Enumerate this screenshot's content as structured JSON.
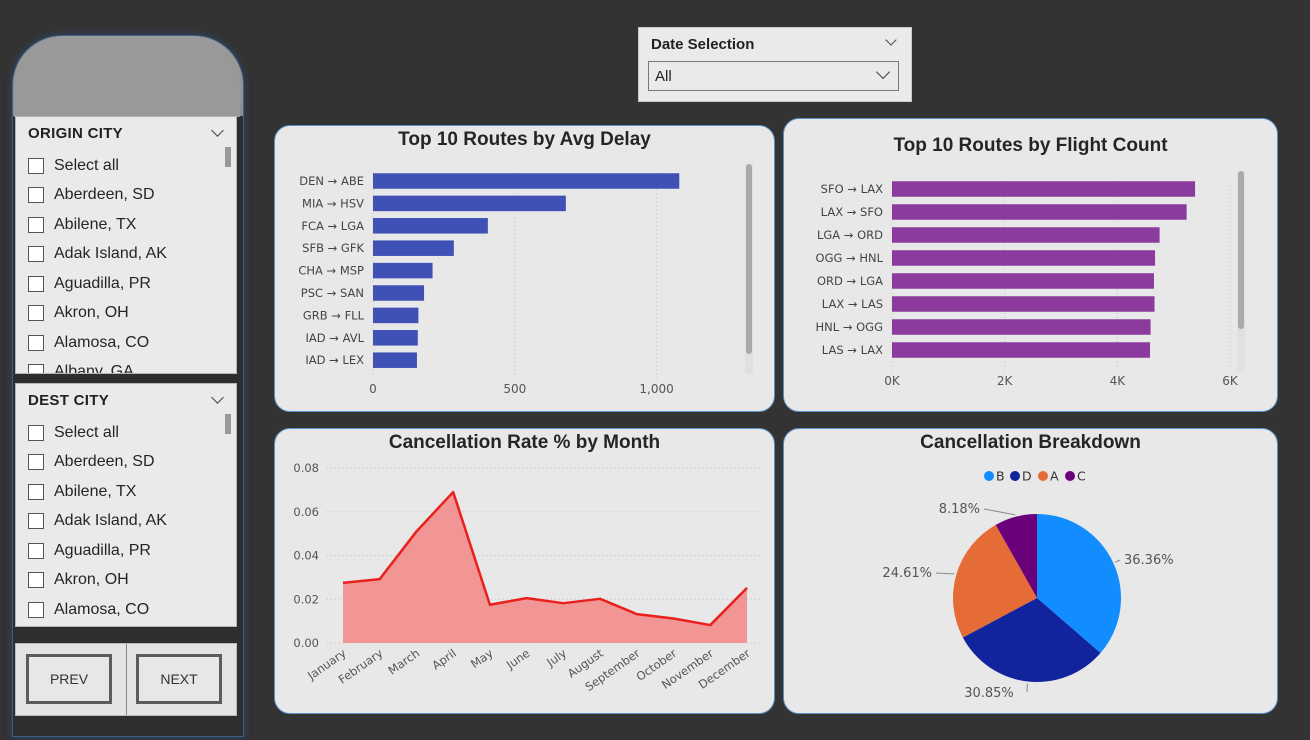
{
  "origin_slicer": {
    "title": "ORIGIN CITY",
    "items": [
      "Select all",
      "Aberdeen, SD",
      "Abilene, TX",
      "Adak Island, AK",
      "Aguadilla, PR",
      "Akron, OH",
      "Alamosa, CO",
      "Albany, GA"
    ]
  },
  "dest_slicer": {
    "title": "DEST CITY",
    "items": [
      "Select all",
      "Aberdeen, SD",
      "Abilene, TX",
      "Adak Island, AK",
      "Aguadilla, PR",
      "Akron, OH",
      "Alamosa, CO"
    ]
  },
  "nav": {
    "prev_label": "PREV",
    "next_label": "NEXT"
  },
  "date_selection": {
    "title": "Date Selection",
    "value": "All"
  },
  "colors": {
    "avg_delay_bar": "#3f51b5",
    "flight_count_bar": "#8b3a9e",
    "area_fill": "#f29595",
    "area_line": "#e8211d",
    "pie_b": "#118dff",
    "pie_d": "#12239e",
    "pie_a": "#e66c37",
    "pie_c": "#6b007b",
    "card_border": "#5a8fc8"
  },
  "chart_data": [
    {
      "type": "bar",
      "orientation": "horizontal",
      "title": "Top 10 Routes by Avg Delay",
      "categories": [
        "DEN → ABE",
        "MIA → HSV",
        "FCA → LGA",
        "SFB → GFK",
        "CHA → MSP",
        "PSC → SAN",
        "GRB → FLL",
        "IAD → AVL",
        "IAD → LEX"
      ],
      "values": [
        1080,
        680,
        405,
        285,
        210,
        180,
        160,
        158,
        155
      ],
      "xlim": [
        0,
        1250
      ],
      "xticks": [
        0,
        500,
        1000
      ],
      "xtick_labels": [
        "0",
        "500",
        "1,000"
      ],
      "grid": true
    },
    {
      "type": "bar",
      "orientation": "horizontal",
      "title": "Top 10 Routes by Flight Count",
      "categories": [
        "SFO → LAX",
        "LAX → SFO",
        "LGA → ORD",
        "OGG → HNL",
        "ORD → LGA",
        "LAX → LAS",
        "HNL → OGG",
        "LAS → LAX"
      ],
      "values": [
        5380,
        5230,
        4750,
        4670,
        4650,
        4660,
        4590,
        4580
      ],
      "xlim": [
        0,
        6000
      ],
      "xticks": [
        0,
        2000,
        4000,
        6000
      ],
      "xtick_labels": [
        "0K",
        "2K",
        "4K",
        "6K"
      ],
      "grid": true
    },
    {
      "type": "area",
      "title": "Cancellation Rate % by Month",
      "categories": [
        "January",
        "February",
        "March",
        "April",
        "May",
        "June",
        "July",
        "August",
        "September",
        "October",
        "November",
        "December"
      ],
      "values": [
        0.0275,
        0.0292,
        0.051,
        0.069,
        0.0175,
        0.0205,
        0.0182,
        0.0202,
        0.0132,
        0.0112,
        0.0082,
        0.0252
      ],
      "ylim": [
        0,
        0.08
      ],
      "yticks": [
        0,
        0.02,
        0.04,
        0.06,
        0.08
      ],
      "ytick_labels": [
        "0.00",
        "0.02",
        "0.04",
        "0.06",
        "0.08"
      ],
      "grid": true
    },
    {
      "type": "pie",
      "title": "Cancellation Breakdown",
      "legend_position": "top",
      "slices": [
        {
          "name": "B",
          "value": 36.36,
          "label": "36.36%"
        },
        {
          "name": "D",
          "value": 30.85,
          "label": "30.85%"
        },
        {
          "name": "A",
          "value": 24.61,
          "label": "24.61%"
        },
        {
          "name": "C",
          "value": 8.18,
          "label": "8.18%"
        }
      ]
    }
  ]
}
